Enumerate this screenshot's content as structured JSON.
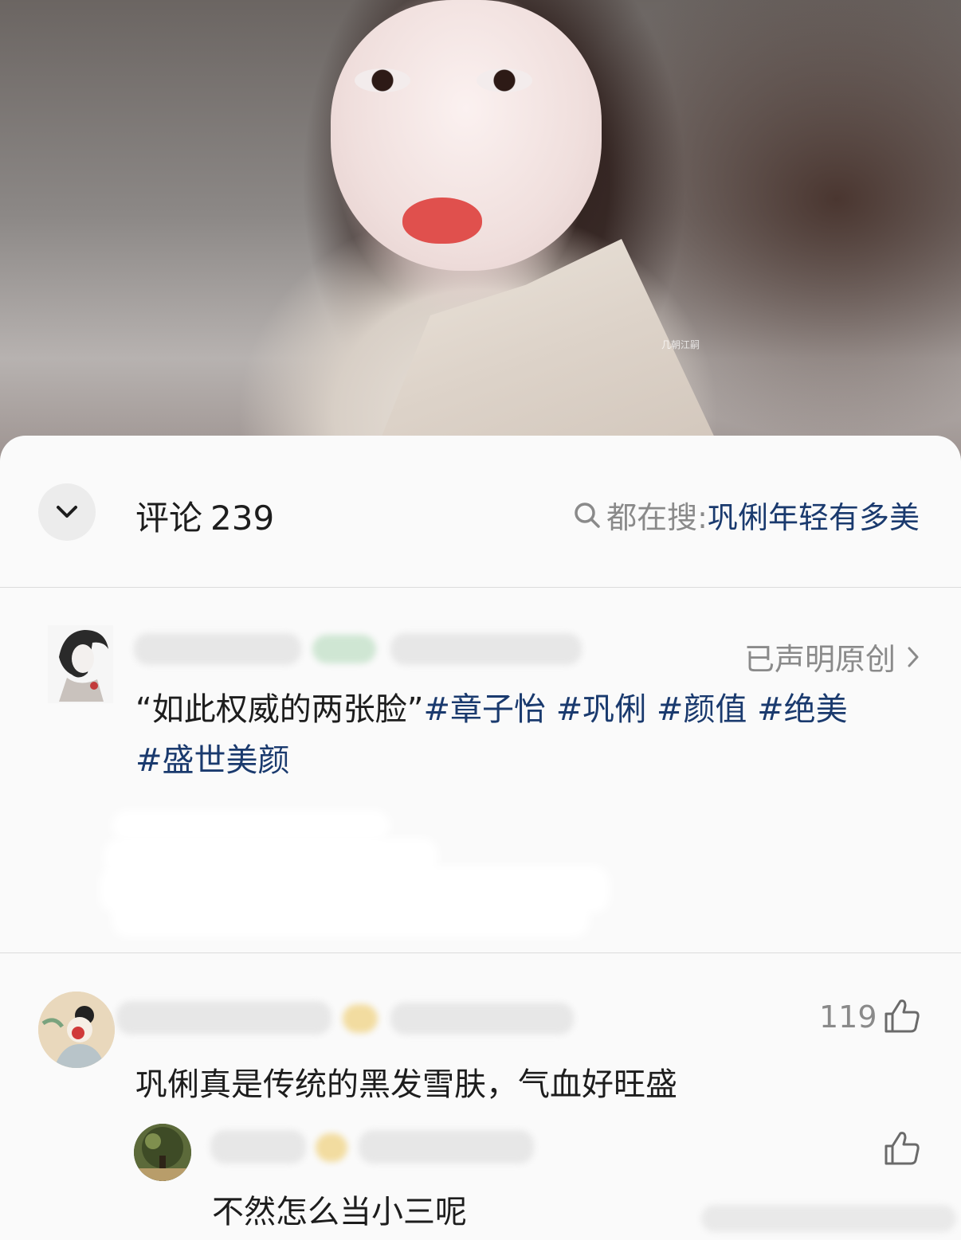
{
  "hero": {
    "watermark": "几朝江嗣"
  },
  "header": {
    "collapse_icon": "chevron-down-icon",
    "comments_label": "评论",
    "comments_count": "239",
    "search_icon": "search-icon",
    "search_prefix": "都在搜:",
    "search_term": "巩俐年轻有多美"
  },
  "post": {
    "original_label": "已声明原创",
    "text_main": "“如此权威的两张脸”",
    "tags": [
      "#章子怡",
      "#巩俐",
      "#颜值",
      "#绝美",
      "#盛世美颜"
    ]
  },
  "comments": [
    {
      "likes": "119",
      "text": "巩俐真是传统的黑发雪肤，气血好旺盛",
      "reply": {
        "likes": "",
        "text": "不然怎么当小三呢"
      }
    }
  ],
  "colors": {
    "link_blue": "#1a3a6e",
    "muted_gray": "#8a8a8a",
    "text_dark": "#1d1d1d"
  }
}
